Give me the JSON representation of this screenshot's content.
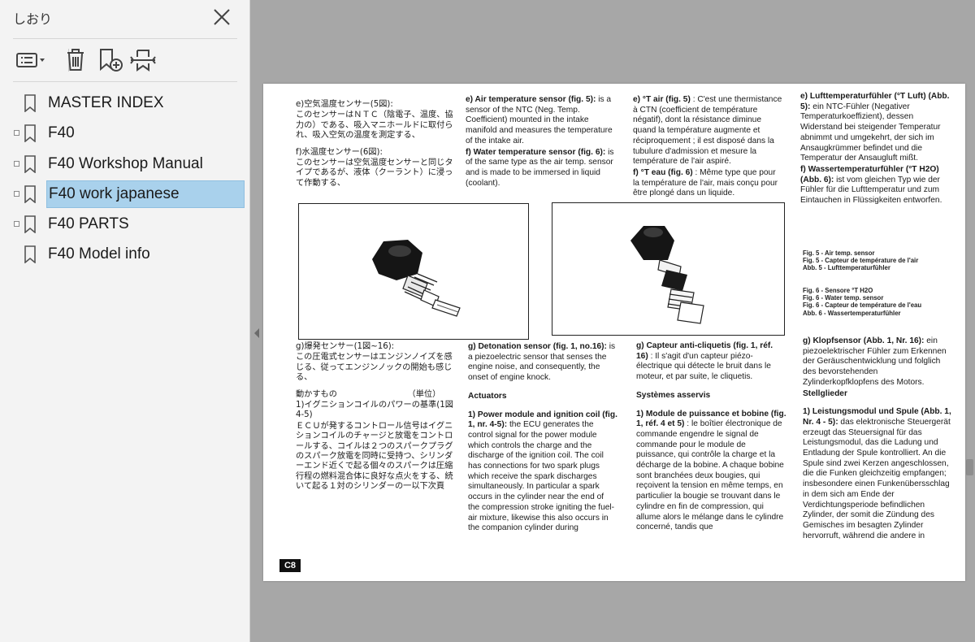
{
  "sidebar": {
    "title": "しおり",
    "close_icon": "close-icon",
    "toolbar": [
      "bookmark-options-icon",
      "delete-bookmark-icon",
      "new-bookmark-icon",
      "expand-bookmark-icon"
    ],
    "bookmarks": [
      {
        "label": "MASTER INDEX",
        "has_children": false,
        "selected": false
      },
      {
        "label": "F40",
        "has_children": true,
        "selected": false
      },
      {
        "label": "F40 Workshop Manual",
        "has_children": true,
        "selected": false
      },
      {
        "label": "F40 work japanese",
        "has_children": true,
        "selected": true
      },
      {
        "label": "F40 PARTS",
        "has_children": true,
        "selected": false
      },
      {
        "label": "F40 Model info",
        "has_children": false,
        "selected": false
      }
    ]
  },
  "document": {
    "page_number": "C8",
    "jp_top": [
      "e)空気温度センサー(5図):",
      "このセンサーはＮＴＣ（陰電子、温度、協力の）である、吸入マニホールドに取付られ、吸入空気の温度を測定する、",
      "f)水温度センサー(6図):",
      "このセンサーは空気温度センサーと同じタイプであるが、液体（クーラント）に浸って作動する、"
    ],
    "en_top": {
      "e_head": "e) Air temperature sensor (fig. 5):",
      "e_body": " is a sensor of the NTC (Neg. Temp. Coefficient) mounted in the intake manifold and measures the temperature of the intake air.",
      "f_head": "f) Water temperature sensor (fig. 6):",
      "f_body": " is of the same type as the air temp. sensor and is made to be immersed in liquid (coolant)."
    },
    "fr_top": {
      "e_head": "e) °T air (fig. 5)",
      "e_body": " : C'est une thermistance à CTN (coefficient de température négatif), dont la résistance diminue quand la température augmente et réciproquement ; il est disposé dans la tubulure d'admission et mesure la température de l'air aspiré.",
      "f_head": "f) °T eau (fig. 6)",
      "f_body": " : Même type que pour la température de l'air, mais conçu pour être plongé dans un liquide."
    },
    "de_top": {
      "e_head": "e) Lufttemperaturfühler (°T Luft) (Abb. 5):",
      "e_body": " ein NTC-Fühler (Negativer Temperaturkoeffizient), dessen Widerstand bei steigender Temperatur abnimmt und umgekehrt, der sich im Ansaugkrümmer befindet und die Temperatur der Ansaugluft mißt.",
      "f_head": "f) Wassertemperaturfühler (°T H2O) (Abb. 6):",
      "f_body": " ist vom gleichen Typ wie der Fühler für die Lufttemperatur und zum Eintauchen in Flüssigkeiten entworfen."
    },
    "captions": {
      "fig5": [
        "Fig. 5 - Air temp. sensor",
        "Fig. 5 - Capteur de température de l'air",
        "Abb. 5 - Lufttemperaturfühler"
      ],
      "fig6": [
        "Fig. 6 - Sensore °T H2O",
        "Fig. 6 - Water temp. sensor",
        "Fig. 6 - Capteur de température de l'eau",
        "Abb. 6 - Wassertemperaturfühler"
      ]
    },
    "jp_bottom": [
      "g)爆発センサー(1図~16):",
      "この圧電式センサーはエンジンノイズを感じる、従ってエンジンノックの開始も感じる、",
      "動かすもの　　　　　　　　　（単位）",
      "1)イグニションコイルのパワーの基準(1図4-5)",
      "ＥＣＵが発するコントロール信号はイグニションコイルのチャージと放電をコントロールする、コイルは２つのスパークプラグのスパーク放電を同時に受持つ、シリンダーエンド近くで起る個々のスパークは圧縮行程の燃料混合体に良好な点火をする、続いて起る１対のシリンダーの一以下次頁"
    ],
    "en_bottom": {
      "g_head": "g) Detonation sensor (fig. 1, no.16):",
      "g_body": " is a piezoelectric sensor that senses the engine noise, and consequently, the onset of engine knock.",
      "act": "Actuators",
      "p1_head": "1) Power module and ignition coil (fig. 1, nr. 4-5):",
      "p1_body": " the ECU generates the control signal for the power module which controls the charge and the discharge of the ignition coil. The coil has connections for two spark plugs which receive the spark discharges simultaneously. In particular a spark occurs in the cylinder near the end of the compression stroke igniting the fuel-air mixture, likewise this also occurs in the companion cylinder during"
    },
    "fr_bottom": {
      "g_head": "g) Capteur anti-cliquetis (fig. 1, réf. 16)",
      "g_body": " : Il s'agit d'un capteur piézo-électrique qui détecte le bruit dans le moteur, et par suite, le cliquetis.",
      "act": "Systèmes asservis",
      "p1_head": "1) Module de puissance et bobine (fig. 1, réf. 4 et 5)",
      "p1_body": " : le boîtier électronique de commande engendre le signal de commande pour le module de puissance, qui contrôle la charge et la décharge de la bobine. A chaque bobine sont branchées deux bougies, qui reçoivent la tension en même temps, en particulier la bougie se trouvant dans le cylindre en fin de compression, qui allume alors le mélange dans le cylindre concerné, tandis que"
    },
    "de_bottom": {
      "g_head": "g) Klopfsensor (Abb. 1, Nr. 16):",
      "g_body": " ein piezoelektrischer Fühler zum Erkennen der Geräuschentwicklung und folglich des bevorstehenden Zylinderkopfklopfens des Motors.",
      "act": "Stellglieder",
      "p1_head": "1) Leistungsmodul und Spule (Abb. 1, Nr. 4 - 5):",
      "p1_body": " das elektronische Steuergerät erzeugt das Steuersignal für das Leistungsmodul, das die Ladung und Entladung der Spule kontrolliert. An die Spule sind zwei Kerzen angeschlossen, die die Funken gleichzeitig empfangen; insbesondere einen Funkenübersschlag in dem sich am Ende der Verdichtungsperiode befindlichen Zylinder, der somit die Zündung des Gemisches im besagten Zylinder hervorruft, während die andere in"
    }
  }
}
